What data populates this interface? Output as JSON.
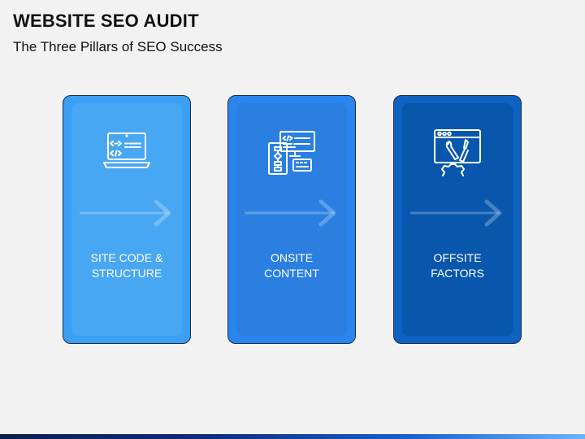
{
  "header": {
    "title": "WEBSITE SEO AUDIT",
    "subtitle": "The Three Pillars of SEO Success"
  },
  "pillars": [
    {
      "label": "SITE CODE &\nSTRUCTURE",
      "icon": "laptop-code-icon",
      "color": "#3b9ff3"
    },
    {
      "label": "ONSITE\nCONTENT",
      "icon": "code-flowchart-icon",
      "color": "#2a86ee"
    },
    {
      "label": "OFFSITE\nFACTORS",
      "icon": "web-tools-icon",
      "color": "#0e62c1"
    }
  ]
}
